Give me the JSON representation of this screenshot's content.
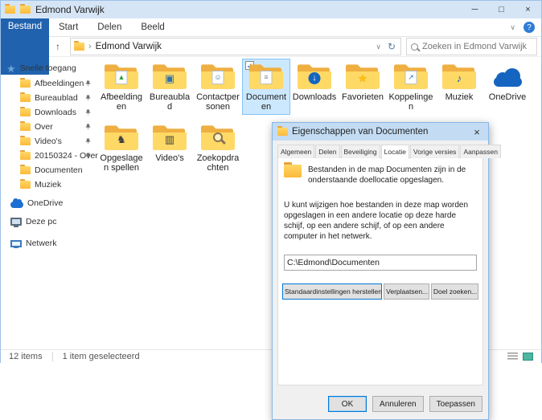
{
  "colors": {
    "accent_blue": "#2062ae",
    "titlebar": "#d5e5f6",
    "selection_fill": "#cce8ff",
    "selection_border": "#84c3f5",
    "folder_yellow": "#ffd766",
    "onedrive_blue": "#1565c0",
    "focus_border": "#0078d7"
  },
  "icons": {
    "minimize": "─",
    "maximize": "□",
    "close": "×",
    "back": "←",
    "forward": "→",
    "up": "↑",
    "down_chevron": "∨",
    "refresh": "↻",
    "breadcrumb_chevron": "›",
    "help": "?",
    "quick_access_star": "★",
    "check": "✓",
    "dialog_close": "×"
  },
  "window": {
    "title": "Edmond Varwijk"
  },
  "menu": {
    "tabs": [
      "Bestand",
      "Start",
      "Delen",
      "Beeld"
    ]
  },
  "address": {
    "path": "Edmond Varwijk",
    "search_placeholder": "Zoeken in Edmond Varwijk"
  },
  "sidebar": {
    "quick_access": "Snelle toegang",
    "items": [
      {
        "label": "Afbeeldingen",
        "pinned": true
      },
      {
        "label": "Bureaublad",
        "pinned": true
      },
      {
        "label": "Downloads",
        "pinned": true
      },
      {
        "label": "Over",
        "pinned": true
      },
      {
        "label": "Video's",
        "pinned": true
      },
      {
        "label": "20150324 - Over",
        "pinned": true
      },
      {
        "label": "Documenten",
        "pinned": false
      },
      {
        "label": "Muziek",
        "pinned": false
      }
    ],
    "roots": [
      {
        "label": "OneDrive"
      },
      {
        "label": "Deze pc"
      },
      {
        "label": "Netwerk"
      }
    ]
  },
  "files": [
    {
      "label": "Afbeeldingen",
      "glyph": "▲"
    },
    {
      "label": "Bureaublad",
      "glyph": "▣"
    },
    {
      "label": "Contactpersonen",
      "glyph": "☺"
    },
    {
      "label": "Documenten",
      "glyph": "≡",
      "selected": true
    },
    {
      "label": "Downloads",
      "glyph": "↓"
    },
    {
      "label": "Favorieten",
      "glyph": "★"
    },
    {
      "label": "Koppelingen",
      "glyph": "↗"
    },
    {
      "label": "Muziek",
      "glyph": "♪"
    },
    {
      "label": "OneDrive",
      "glyph": ""
    },
    {
      "label": "Opgeslagen spellen",
      "glyph": "♞"
    },
    {
      "label": "Video's",
      "glyph": "▥"
    },
    {
      "label": "Zoekopdrachten",
      "glyph": ""
    }
  ],
  "status": {
    "items": "12 items",
    "selected": "1 item geselecteerd"
  },
  "dialog": {
    "title": "Eigenschappen van Documenten",
    "tabs": [
      "Algemeen",
      "Delen",
      "Beveiliging",
      "Locatie",
      "Vorige versies",
      "Aanpassen"
    ],
    "active_tab": "Locatie",
    "intro": "Bestanden in de map Documenten zijn in de onderstaande doellocatie opgeslagen.",
    "description": "U kunt wijzigen hoe bestanden in deze map worden opgeslagen in een andere locatie op deze harde schijf, op een andere schijf, of op een andere computer in het netwerk.",
    "location_value": "C:\\Edmond\\Documenten",
    "buttons": {
      "restore": "Standaardinstellingen herstellen",
      "move": "Verplaatsen...",
      "target": "Doel zoeken..."
    },
    "footer": {
      "ok": "OK",
      "cancel": "Annuleren",
      "apply": "Toepassen"
    }
  }
}
